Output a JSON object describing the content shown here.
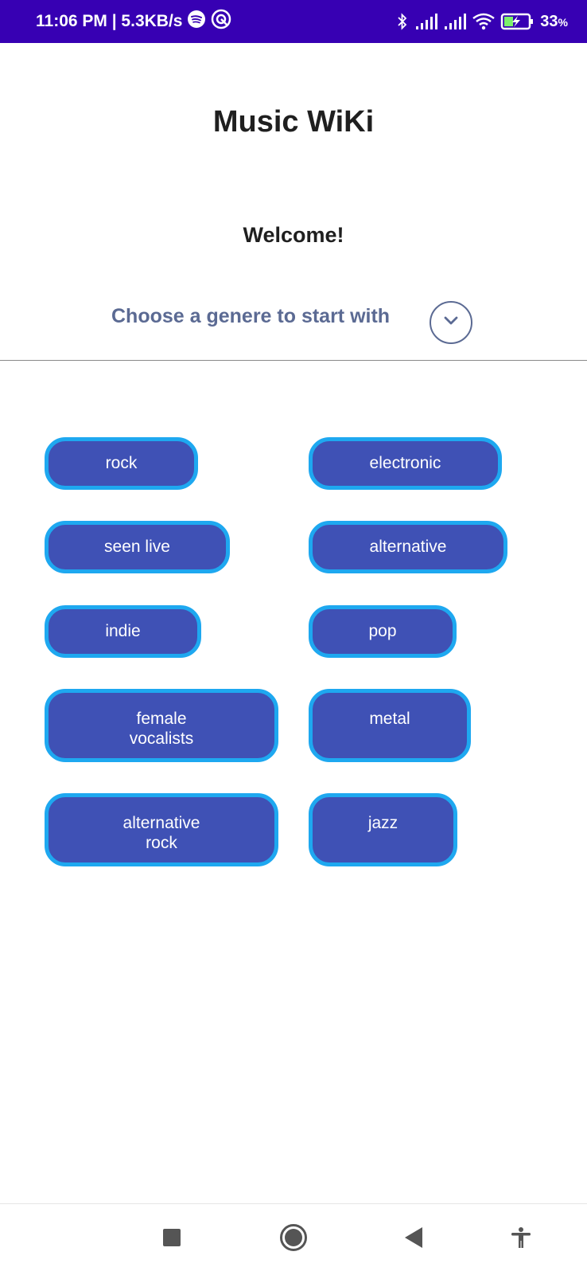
{
  "status_bar": {
    "time_speed": "11:06 PM | 5.3KB/s",
    "battery_percent": "33",
    "battery_symbol": "%",
    "icons": [
      "spotify-icon",
      "sync-icon",
      "bluetooth-icon",
      "signal-icon",
      "signal-icon",
      "wifi-icon",
      "battery-charging-icon"
    ]
  },
  "header": {
    "title": "Music WiKi",
    "welcome": "Welcome!",
    "prompt": "Choose a genere to start with",
    "expand_icon": "chevron-down-icon"
  },
  "genres": [
    {
      "label": "rock"
    },
    {
      "label": "electronic"
    },
    {
      "label": "seen live"
    },
    {
      "label": "alternative"
    },
    {
      "label": "indie"
    },
    {
      "label": "pop"
    },
    {
      "label": "female\nvocalists"
    },
    {
      "label": "metal"
    },
    {
      "label": "alternative\nrock"
    },
    {
      "label": "jazz"
    }
  ],
  "nav_bar": {
    "icons": [
      "recents-icon",
      "home-icon",
      "back-icon",
      "accessibility-icon"
    ]
  },
  "colors": {
    "status_bar": "#3700b3",
    "chip_fill": "#3f51b5",
    "chip_border": "#1ea8f0",
    "prompt_text": "#5b6a93"
  }
}
